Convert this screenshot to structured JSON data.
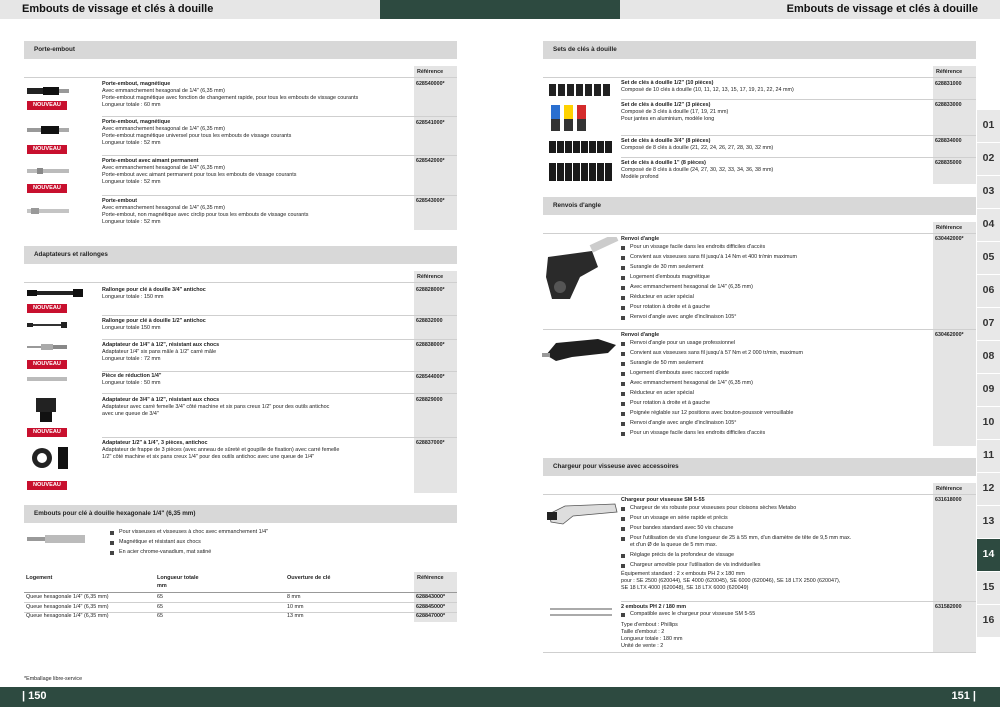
{
  "header": {
    "left_title": "Embouts de vissage et clés à douille",
    "right_title": "Embouts de vissage et clés à douille"
  },
  "ref_label": "Référence",
  "badge": "NOUVEAU",
  "left": {
    "s1": {
      "title": "Porte-embout",
      "items": [
        {
          "name": "Porte-embout, magnétique",
          "lines": [
            "Avec emmanchement hexagonal de 1/4\" (6,35 mm)",
            "Porte-embout magnétique avec fonction de changement rapide, pour tous les embouts de vissage courants",
            "Longueur totale : 60 mm"
          ],
          "ref": "628540000*"
        },
        {
          "name": "Porte-embout, magnétique",
          "lines": [
            "Avec emmanchement hexagonal de 1/4\" (6,35 mm)",
            "Porte-embout magnétique universel pour tous les embouts de vissage courants",
            "Longueur totale : 52 mm"
          ],
          "ref": "628541000*"
        },
        {
          "name": "Porte-embout avec aimant permanent",
          "lines": [
            "Avec emmanchement hexagonal de 1/4\" (6,35 mm)",
            "Porte-embout avec aimant permanent pour tous les embouts de vissage courants",
            "Longueur totale : 52 mm"
          ],
          "ref": "628542000*"
        },
        {
          "name": "Porte-embout",
          "lines": [
            "Avec emmanchement hexagonal de 1/4\" (6,35 mm)",
            "Porte-embout, non magnétique avec circlip pour tous les embouts de vissage courants",
            "Longueur totale : 52 mm"
          ],
          "ref": "628543000*"
        }
      ]
    },
    "s2": {
      "title": "Adaptateurs et rallonges",
      "items": [
        {
          "name": "Rallonge pour clé à douille 3/4\" antichoc",
          "lines": [
            "Longueur totale : 150 mm"
          ],
          "ref": "628828000*"
        },
        {
          "name": "Rallonge pour clé à douille 1/2\" antichoc",
          "lines": [
            "Longueur totale 150 mm"
          ],
          "ref": "628832000"
        },
        {
          "name": "Adaptateur de 1/4\" à 1/2\", résistant aux chocs",
          "lines": [
            "Adaptateur 1/4\" six pans mâle à 1/2\" carré mâle",
            "Longueur totale : 72 mm"
          ],
          "ref": "628838000*"
        },
        {
          "name": "Pièce de réduction 1/4\"",
          "lines": [
            "Longueur totale : 50 mm"
          ],
          "ref": "628544000*"
        },
        {
          "name": "Adaptateur de 3/4\" à 1/2\", résistant aux chocs",
          "lines": [
            "Adaptateur avec carré femelle 3/4\" côté machine et six pans creux 1/2\" pour des outils antichoc",
            "avec une queue de 3/4\""
          ],
          "ref": "628829000"
        },
        {
          "name": "Adaptateur 1/2\" à 1/4\", 3 pièces, antichoc",
          "lines": [
            "Adaptateur de frappe de 3 pièces (avec anneau de sûreté et goupille de fixation) avec carré femelle",
            "1/2\" côté machine et six pans creux 1/4\" pour des outils antichoc avec une queue de 1/4\""
          ],
          "ref": "628837000*"
        }
      ]
    },
    "s3": {
      "title": "Embouts pour clé à douille hexagonale 1/4\" (6,35 mm)",
      "bullets": [
        "Pour visseuses et visseuses à choc avec emmanchement 1/4\"",
        "Magnétique et résistant aux chocs",
        "En acier chrome-vanadium, mat satiné"
      ],
      "table": {
        "headers": [
          "Logement",
          "Longueur totale",
          "mm",
          "Ouverture de clé",
          "Référence"
        ],
        "rows": [
          [
            "Queue hexagonale 1/4\" (6,35 mm)",
            "65",
            "8 mm",
            "628843000*"
          ],
          [
            "Queue hexagonale 1/4\" (6,35 mm)",
            "65",
            "10 mm",
            "628845000*"
          ],
          [
            "Queue hexagonale 1/4\" (6,35 mm)",
            "65",
            "13 mm",
            "628847000*"
          ]
        ]
      }
    },
    "footnote": "*Emballage libre-service",
    "page": "| 150"
  },
  "right": {
    "s1": {
      "title": "Sets de clés à douille",
      "items": [
        {
          "name": "Set de clés à douille 1/2\" (10 pièces)",
          "lines": [
            "Composé de 10 clés à douille (10, 11, 12, 13, 15, 17, 19, 21, 22, 24 mm)"
          ],
          "ref": "628831000"
        },
        {
          "name": "Set de clés à douille 1/2\" (3 pièces)",
          "lines": [
            "Composé de 3 clés à douille (17, 19, 21 mm)",
            "Pour jantes en aluminium, modèle long"
          ],
          "ref": "628833000"
        },
        {
          "name": "Set de clés à douille 3/4\" (8 pièces)",
          "lines": [
            "Composé de 8 clés à douille (21, 22, 24, 26, 27, 28, 30, 32 mm)"
          ],
          "ref": "628834000"
        },
        {
          "name": "Set de clés à douille 1\" (8 pièces)",
          "lines": [
            "Composé de 8 clés à douille (24, 27, 30, 32, 33, 34, 36, 38 mm)",
            "Modèle profond"
          ],
          "ref": "628835000"
        }
      ]
    },
    "s2": {
      "title": "Renvois d'angle",
      "items": [
        {
          "name": "Renvoi d'angle",
          "bullets": [
            "Pour un vissage facile dans les endroits difficiles d'accès",
            "Convient aux visseuses sans fil jusqu'à 14 Nm et 400 tr/min maximum",
            "Surangle de 30 mm seulement",
            "Logement d'embouts magnétique",
            "Avec emmanchement hexagonal de 1/4\" (6,35 mm)",
            "Réducteur en acier spécial",
            "Pour rotation à droite et à gauche",
            "Renvoi d'angle avec angle d'inclinaison 105°"
          ],
          "ref": "630442000*"
        },
        {
          "name": "Renvoi d'angle",
          "bullets": [
            "Renvoi d'angle pour un usage professionnel",
            "Convient aux visseuses sans fil jusqu'à 57 Nm et 2 000 tr/min, maximum",
            "Surangle de 50 mm seulement",
            "Logement d'embouts avec raccord rapide",
            "Avec emmanchement hexagonal de 1/4\" (6,35 mm)",
            "Réducteur en acier spécial",
            "Pour rotation à droite et à gauche",
            "Poignée réglable sur 12 positions avec bouton-poussoir verrouillable",
            "Renvoi d'angle avec angle d'inclinaison 105°",
            "Pour un vissage facile dans les endroits difficiles d'accès"
          ],
          "ref": "630462000*"
        }
      ]
    },
    "s3": {
      "title": "Chargeur pour visseuse avec accessoires",
      "items": [
        {
          "name": "Chargeur pour visseuse SM 5-55",
          "bullets": [
            "Chargeur de vis robuste pour visseuses pour cloisons sèches Metabo",
            "Pour un vissage en série rapide et précis",
            "Pour bandes standard avec 50 vis chacune",
            "Pour l'utilisation de vis d'une longueur de 25 à 55 mm, d'un diamètre de tête de 9,5 mm max.",
            "Réglage précis de la profondeur de vissage",
            "Chargeur amovible pour l'utilisation de vis individuelles"
          ],
          "bullet4b": "et d'un Ø de la queue de 5 mm max.",
          "extra": [
            "Équipement standard : 2 x embouts PH 2 x 180 mm",
            "pour : SE 2500 (620044), SE 4000 (620045), SE 6000 (620046), SE 18 LTX 2500 (620047),",
            "SE 18 LTX 4000 (620048), SE 18 LTX 6000 (620049)"
          ],
          "ref": "631618000"
        },
        {
          "name": "2 embouts PH 2 / 180 mm",
          "bullets": [
            "Compatible avec le chargeur pour visseuse SM 5-55"
          ],
          "extra": [
            "Type d'embout : Phillips",
            "Taille d'embout : 2",
            "Longueur totale : 180 mm",
            "Unité de vente : 2"
          ],
          "ref": "631582000"
        }
      ]
    },
    "page": "151 |"
  },
  "tabs": [
    "01",
    "02",
    "03",
    "04",
    "05",
    "06",
    "07",
    "08",
    "09",
    "10",
    "11",
    "12",
    "13",
    "14",
    "15",
    "16"
  ],
  "active_tab": "14",
  "colors": {
    "green": "#2d4a40",
    "red": "#c8102e",
    "gray": "#d8d8d8"
  }
}
